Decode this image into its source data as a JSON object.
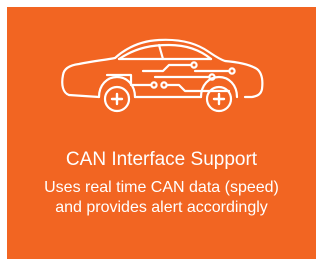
{
  "card": {
    "background_color": "#f26522",
    "text_color": "#ffffff",
    "icon": "car-circuit-icon",
    "title": "CAN Interface Support",
    "description_line1": "Uses real time CAN data (speed)",
    "description_line2": "and provides alert accordingly"
  }
}
